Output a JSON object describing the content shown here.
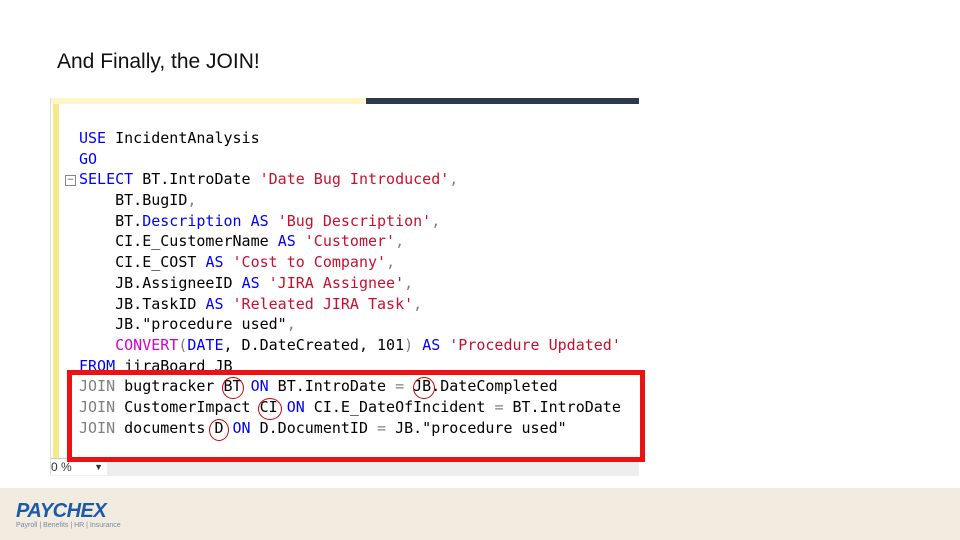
{
  "slide": {
    "title": "And Finally, the JOIN!"
  },
  "editor": {
    "zoom": "0 %",
    "lines": [
      [
        [
          "USE",
          "kw"
        ],
        [
          " IncidentAnalysis",
          "id"
        ]
      ],
      [
        [
          "GO",
          "kw"
        ]
      ],
      [
        [
          "SELECT",
          "kw"
        ],
        [
          " BT.IntroDate ",
          "id"
        ],
        [
          "'Date Bug Introduced'",
          "str"
        ],
        [
          ",",
          "gray"
        ]
      ],
      [
        [
          "    BT.BugID",
          "id"
        ],
        [
          ",",
          "gray"
        ]
      ],
      [
        [
          "    BT.",
          "id"
        ],
        [
          "Description",
          "kw"
        ],
        [
          " AS ",
          "kw"
        ],
        [
          "'Bug Description'",
          "str"
        ],
        [
          ",",
          "gray"
        ]
      ],
      [
        [
          "    CI.E_CustomerName ",
          "id"
        ],
        [
          "AS ",
          "kw"
        ],
        [
          "'Customer'",
          "str"
        ],
        [
          ",",
          "gray"
        ]
      ],
      [
        [
          "    CI.E_COST ",
          "id"
        ],
        [
          "AS ",
          "kw"
        ],
        [
          "'Cost to Company'",
          "str"
        ],
        [
          ",",
          "gray"
        ]
      ],
      [
        [
          "    JB.AssigneeID ",
          "id"
        ],
        [
          "AS ",
          "kw"
        ],
        [
          "'JIRA Assignee'",
          "str"
        ],
        [
          ",",
          "gray"
        ]
      ],
      [
        [
          "    JB.TaskID ",
          "id"
        ],
        [
          "AS ",
          "kw"
        ],
        [
          "'Releated JIRA Task'",
          "str"
        ],
        [
          ",",
          "gray"
        ]
      ],
      [
        [
          "    JB.\"procedure used\"",
          "id"
        ],
        [
          ",",
          "gray"
        ]
      ],
      [
        [
          "    CONVERT",
          "fn"
        ],
        [
          "(",
          "gray"
        ],
        [
          "DATE",
          "kw"
        ],
        [
          ", D.DateCreated, 101",
          "id"
        ],
        [
          ") ",
          "gray"
        ],
        [
          "AS ",
          "kw"
        ],
        [
          "'Procedure Updated'",
          "str"
        ]
      ],
      [
        [
          "FROM",
          "kw"
        ],
        [
          " jiraBoard JB",
          "id"
        ]
      ],
      [
        [
          "JOIN",
          "gray"
        ],
        [
          " bugtracker BT ",
          "id"
        ],
        [
          "ON",
          "kw"
        ],
        [
          " BT.IntroDate ",
          "id"
        ],
        [
          "=",
          "gray"
        ],
        [
          " JB.DateCompleted",
          "id"
        ]
      ],
      [
        [
          "JOIN",
          "gray"
        ],
        [
          " CustomerImpact CI ",
          "id"
        ],
        [
          "ON",
          "kw"
        ],
        [
          " CI.E_DateOfIncident ",
          "id"
        ],
        [
          "=",
          "gray"
        ],
        [
          " BT.IntroDate",
          "id"
        ]
      ],
      [
        [
          "JOIN",
          "gray"
        ],
        [
          " documents D ",
          "id"
        ],
        [
          "ON",
          "kw"
        ],
        [
          " D.DocumentID ",
          "id"
        ],
        [
          "=",
          "gray"
        ],
        [
          " JB.\"procedure used\"",
          "id"
        ]
      ]
    ]
  },
  "highlight": {
    "color": "#ee1111"
  },
  "footer": {
    "logo": "PAYCHEX",
    "tagline": "Payroll | Benefits | HR | Insurance"
  }
}
